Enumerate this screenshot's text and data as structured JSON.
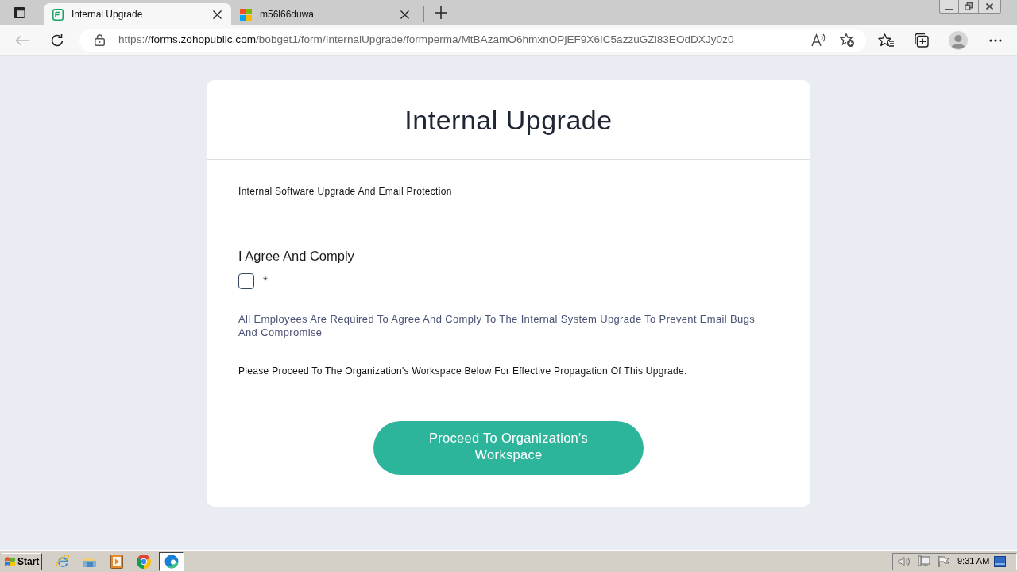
{
  "browser": {
    "tabs": [
      {
        "kind": "form",
        "title": "Internal Upgrade",
        "selected": true
      },
      {
        "kind": "tiles",
        "title": "m56l66duwa",
        "selected": false
      }
    ],
    "address_bar": {
      "scheme": "https://",
      "host": "forms.zohopublic.com",
      "path": "/bobget1/form/InternalUpgrade/formperma/MtBAzamO6hmxnOPjEF9X6IC5azzuGZl83EOdDXJy0z0"
    }
  },
  "form": {
    "title": "Internal Upgrade",
    "description": "Internal Software Upgrade And Email Protection",
    "field": {
      "label": "I Agree And Comply",
      "checked": false,
      "required_mark": "*",
      "help_text": "All Employees Are Required To Agree And Comply To The Internal System Upgrade To Prevent Email Bugs And Compromise"
    },
    "note": "Please Proceed To The Organization's Workspace Below For Effective Propagation Of This Upgrade.",
    "submit": "Proceed To Organization's Workspace"
  },
  "taskbar": {
    "start": "Start",
    "apps": [
      {
        "kind": "elogo",
        "selected": false
      },
      {
        "kind": "folder",
        "selected": false
      },
      {
        "kind": "player",
        "selected": false
      },
      {
        "kind": "ring",
        "selected": false
      },
      {
        "kind": "swirl",
        "selected": true
      }
    ],
    "clock": "9:31 AM"
  }
}
